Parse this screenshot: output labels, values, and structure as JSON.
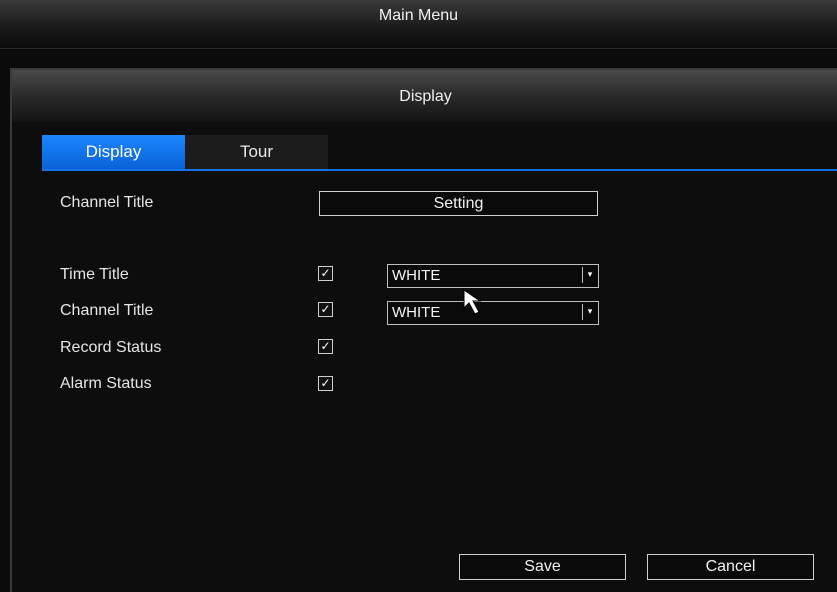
{
  "main_menu": {
    "title": "Main Menu"
  },
  "dialog": {
    "title": "Display",
    "tabs": [
      {
        "label": "Display",
        "active": true
      },
      {
        "label": "Tour",
        "active": false
      }
    ],
    "channel_title_setting": {
      "label": "Channel Title",
      "button_label": "Setting"
    },
    "rows": [
      {
        "label": "Time Title",
        "checked": true,
        "checkmark": "✓",
        "color": "WHITE"
      },
      {
        "label": "Channel Title",
        "checked": true,
        "checkmark": "✓",
        "color": "WHITE"
      },
      {
        "label": "Record Status",
        "checked": true,
        "checkmark": "✓"
      },
      {
        "label": "Alarm Status",
        "checked": true,
        "checkmark": "✓"
      }
    ],
    "dropdown_arrow": "▾",
    "save_label": "Save",
    "cancel_label": "Cancel"
  },
  "colors": {
    "tab_active": "#1c86ff",
    "tab_underline": "#1672e8",
    "background": "#0d0d0d"
  }
}
